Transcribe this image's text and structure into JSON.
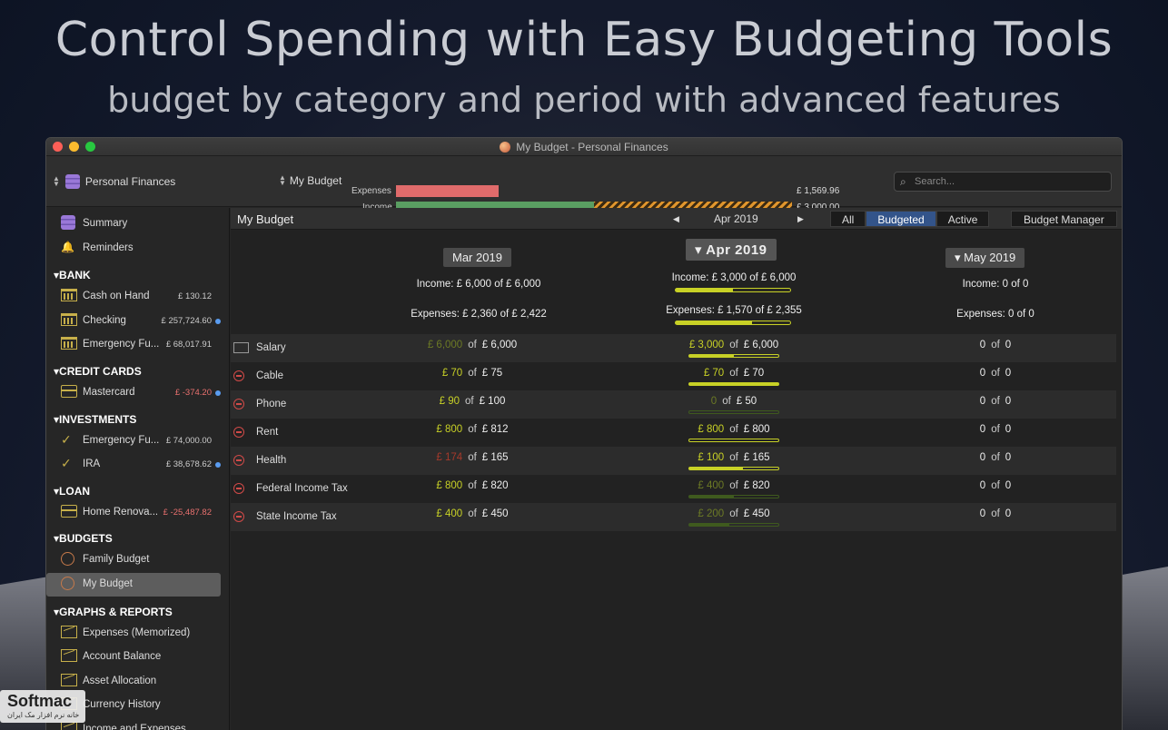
{
  "hero": {
    "title": "Control Spending with Easy Budgeting Tools",
    "subtitle": "budget by category and period with advanced features"
  },
  "window": {
    "title": "My Budget - Personal Finances"
  },
  "toolbar": {
    "file_select": "Personal Finances",
    "budget_select": "My Budget",
    "expenses_label": "Expenses",
    "income_label": "Income",
    "expenses_value": "£ 1,569.96",
    "income_value": "£ 3,000.00",
    "expenses_fraction": 0.26,
    "income_fraction": 0.5,
    "search_placeholder": "Search..."
  },
  "sidebar": {
    "top": [
      {
        "label": "Summary",
        "icon": "database-icon"
      },
      {
        "label": "Reminders",
        "icon": "bell-icon"
      }
    ],
    "bank_header": "BANK",
    "bank": [
      {
        "label": "Cash on Hand",
        "amount": "£ 130.12"
      },
      {
        "label": "Checking",
        "amount": "£ 257,724.60"
      },
      {
        "label": "Emergency Fu...",
        "amount": "£ 68,017.91"
      }
    ],
    "cards_header": "CREDIT CARDS",
    "cards": [
      {
        "label": "Mastercard",
        "amount": "£ -374.20"
      }
    ],
    "inv_header": "INVESTMENTS",
    "investments": [
      {
        "label": "Emergency Fu...",
        "amount": "£ 74,000.00"
      },
      {
        "label": "IRA",
        "amount": "£ 38,678.62"
      }
    ],
    "loan_header": "LOAN",
    "loans": [
      {
        "label": "Home Renova...",
        "amount": "£ -25,487.82"
      }
    ],
    "budgets_header": "BUDGETS",
    "budgets": [
      {
        "label": "Family Budget"
      },
      {
        "label": "My Budget"
      }
    ],
    "reports_header": "GRAPHS & REPORTS",
    "reports": [
      {
        "label": "Expenses (Memorized)"
      },
      {
        "label": "Account Balance"
      },
      {
        "label": "Asset Allocation"
      },
      {
        "label": "Currency History"
      },
      {
        "label": "Income and Expenses"
      }
    ]
  },
  "main": {
    "title": "My Budget",
    "period": "Apr 2019",
    "filters": [
      "All",
      "Budgeted",
      "Active"
    ],
    "active_filter": "Budgeted",
    "manager_button": "Budget Manager",
    "periods": [
      {
        "name": "Mar 2019",
        "income": "Income: £ 6,000 of £ 6,000",
        "expenses": "Expenses: £ 2,360 of £ 2,422"
      },
      {
        "name": "Apr 2019",
        "income": "Income: £ 3,000 of £ 6,000",
        "expenses": "Expenses: £ 1,570 of £ 2,355",
        "income_fraction": 0.5,
        "expenses_fraction": 0.67
      },
      {
        "name": "May 2019",
        "income": "Income: 0 of 0",
        "expenses": "Expenses: 0 of 0"
      }
    ],
    "of_word": "of",
    "rows": [
      {
        "cat": "Salary",
        "type": "income",
        "mar": [
          "£ 6,000",
          "£ 6,000",
          "dim"
        ],
        "apr": [
          "£ 3,000",
          "£ 6,000",
          "on",
          0.5
        ],
        "may": [
          "0",
          "0"
        ]
      },
      {
        "cat": "Cable",
        "type": "expense",
        "mar": [
          "£ 70",
          "£ 75",
          "on"
        ],
        "apr": [
          "£ 70",
          "£ 70",
          "on",
          1.0
        ],
        "may": [
          "0",
          "0"
        ]
      },
      {
        "cat": "Phone",
        "type": "expense",
        "mar": [
          "£ 90",
          "£ 100",
          "on"
        ],
        "apr": [
          "0",
          "£ 50",
          "dim",
          0
        ],
        "may": [
          "0",
          "0"
        ]
      },
      {
        "cat": "Rent",
        "type": "expense",
        "mar": [
          "£ 800",
          "£ 812",
          "on"
        ],
        "apr": [
          "£ 800",
          "£ 800",
          "on",
          0.0
        ],
        "may": [
          "0",
          "0"
        ]
      },
      {
        "cat": "Health",
        "type": "expense",
        "mar": [
          "£ 174",
          "£ 165",
          "red"
        ],
        "apr": [
          "£ 100",
          "£ 165",
          "on",
          0.6
        ],
        "may": [
          "0",
          "0"
        ]
      },
      {
        "cat": "Federal Income Tax",
        "type": "expense",
        "mar": [
          "£ 800",
          "£ 820",
          "on"
        ],
        "apr": [
          "£ 400",
          "£ 820",
          "dim",
          0.5
        ],
        "may": [
          "0",
          "0"
        ]
      },
      {
        "cat": "State Income Tax",
        "type": "expense",
        "mar": [
          "£ 400",
          "£ 450",
          "on"
        ],
        "apr": [
          "£ 200",
          "£ 450",
          "dim",
          0.45
        ],
        "may": [
          "0",
          "0"
        ]
      }
    ]
  },
  "watermark": {
    "brand": "Softmac",
    "tagline": "خانه نرم افزار مک ایران"
  },
  "colors": {
    "accent": "#c8d126",
    "expense": "#e06b6b",
    "income": "#5a9e62",
    "selected": "#33548a"
  }
}
